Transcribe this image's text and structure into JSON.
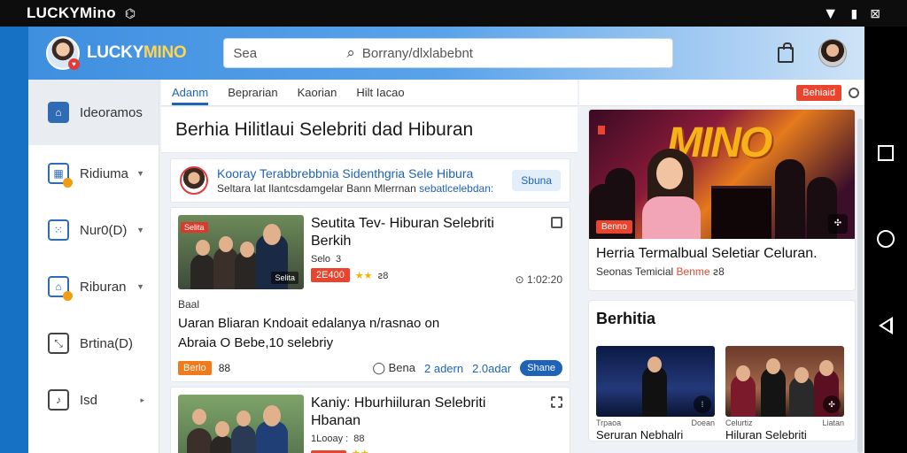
{
  "statusbar": {
    "title": "LUCKYMino",
    "left_icon": "signal-icon",
    "right_icons": [
      "wifi-icon",
      "battery-icon",
      "signal-x-icon"
    ]
  },
  "app": {
    "logo": {
      "text_a": "LUCKY",
      "text_b": "MINO"
    },
    "search": {
      "left_text": "Sea",
      "placeholder": "Borrany/dlxlabebnt"
    }
  },
  "sidebar": {
    "items": [
      {
        "label": "Ideoramos",
        "icon": "home-icon"
      },
      {
        "label": "Ridiuma",
        "icon": "calendar-icon",
        "caret": "▼"
      },
      {
        "label": "Nur0(D)",
        "icon": "dice-icon",
        "caret": "▼"
      },
      {
        "label": "Riburan",
        "icon": "home-alt-icon",
        "caret": "▼"
      },
      {
        "label": "Brtina(D)",
        "icon": "chart-icon"
      },
      {
        "label": "Isd",
        "icon": "music-icon",
        "caret": "▸"
      }
    ]
  },
  "main": {
    "tabs": [
      "Adanm",
      "Beprarian",
      "Kaorian",
      "Hilt Iacao"
    ],
    "page_title": "Berhia Hilitlaui Selebriti dad Hiburan",
    "feature": {
      "title": "Kooray Terabbrebbnia Sidenthgria Sele Hibura",
      "sub_a": "Seltara Iat Ilantcsdamgelar Bann Mlerrnan",
      "sub_link": "sebatlcelebdan:",
      "button": "Sbuna"
    },
    "card1": {
      "title_1": "Seutita Tev- Hiburan Selebriti",
      "title_2": "Berkih",
      "thumb_badge": "Selita",
      "thumb_corner": "Selita",
      "meta_tag": "Selo",
      "meta_count": "3",
      "tag": "2E400",
      "stars": "★★",
      "tag_extra": "ꙅ8",
      "time": "1:02:20",
      "label": "Baal",
      "desc_1": "Uaran Bliaran Kndoait edalanya n/rasnao on",
      "desc_2": "Abraia O Bebe,10 selebriy",
      "foot_tag": "Berlo",
      "foot_count": "88",
      "foot_a": "Bena",
      "foot_b": "2 adern",
      "foot_c": "2.0adar",
      "share": "Shane"
    },
    "card2": {
      "title_1": "Kaniy: Hburhiiluran Selebriti",
      "title_2": "Hbanan",
      "meta_tag": "1Looay :",
      "meta_count": "88",
      "stars": "★★"
    }
  },
  "right": {
    "red_button": "Behiaid",
    "hero": {
      "logo_text": "MINO",
      "badge": "Benno",
      "caption": "Herria Termalbual Seletiar Celuran.",
      "sub_a": "Seonas Temicial",
      "sub_red": "Benme",
      "sub_b": "ꙅ8"
    },
    "berita": {
      "title": "Berhitia",
      "items": [
        {
          "meta_left": "Trpaoa",
          "meta_right": "Doean",
          "caption": "Seruran Nebhalri"
        },
        {
          "meta_left": "Celurtiz",
          "meta_right": "Liatan",
          "caption": "Hiluran Selebriti"
        }
      ]
    }
  },
  "colors": {
    "accent": "#1e63b8",
    "red": "#e8442e",
    "orange": "#f07b1d",
    "gold": "#f7b21a"
  }
}
